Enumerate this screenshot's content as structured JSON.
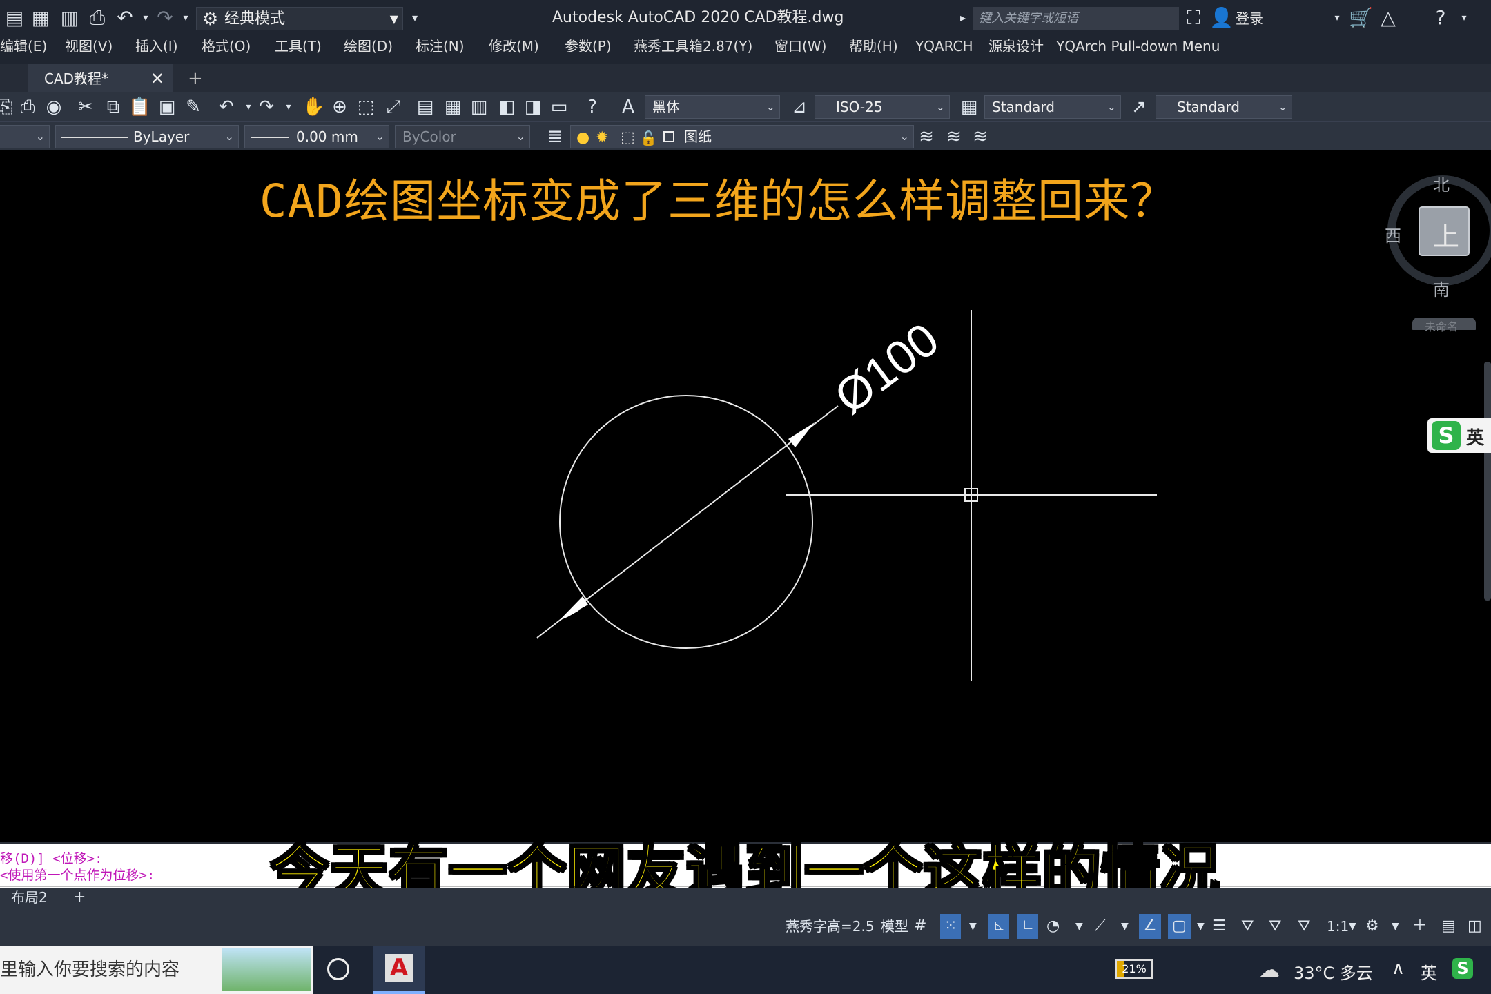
{
  "titlebar": {
    "workspace": "经典模式",
    "app_title": "Autodesk AutoCAD 2020    CAD教程.dwg",
    "search_placeholder": "键入关键字或短语",
    "login": "登录"
  },
  "menubar": {
    "items": [
      "编辑(E)",
      "视图(V)",
      "插入(I)",
      "格式(O)",
      "工具(T)",
      "绘图(D)",
      "标注(N)",
      "修改(M)",
      "参数(P)",
      "燕秀工具箱2.87(Y)",
      "窗口(W)",
      "帮助(H)",
      "YQARCH",
      "源泉设计",
      "YQArch Pull-down Menu"
    ]
  },
  "tabs": {
    "document": "CAD教程*",
    "new_tab": "+"
  },
  "toolbar1": {
    "text_font": "黑体",
    "dim_style": "ISO-25",
    "table_style": "Standard",
    "multileader_style": "Standard"
  },
  "toolbar2": {
    "linetype": "ByLayer",
    "lineweight": "0.00 mm",
    "plot_style": "ByColor",
    "layer": "图纸"
  },
  "canvas": {
    "banner": "CAD绘图坐标变成了三维的怎么样调整回来？",
    "dimension_text": "Ø100",
    "background": "#000000",
    "banner_color": "#f2a51c"
  },
  "viewcube": {
    "north": "北",
    "south": "南",
    "west": "西",
    "face": "上",
    "wcs": "未命名"
  },
  "ime_float": {
    "label": "英"
  },
  "command": {
    "line1": "移(D)] <位移>:",
    "line2": " <使用第一个点作为位移>:",
    "subtitle": "今天有一个网友遇到一个这样的情况"
  },
  "layouts": {
    "tab": "布局2",
    "add": "+"
  },
  "statusbar": {
    "text_height": "燕秀字高=2.5",
    "model": "模型",
    "scale": "1:1"
  },
  "taskbar": {
    "search": "里输入你要搜索的内容",
    "battery": "21%",
    "weather": "33°C 多云",
    "ime": "英"
  }
}
